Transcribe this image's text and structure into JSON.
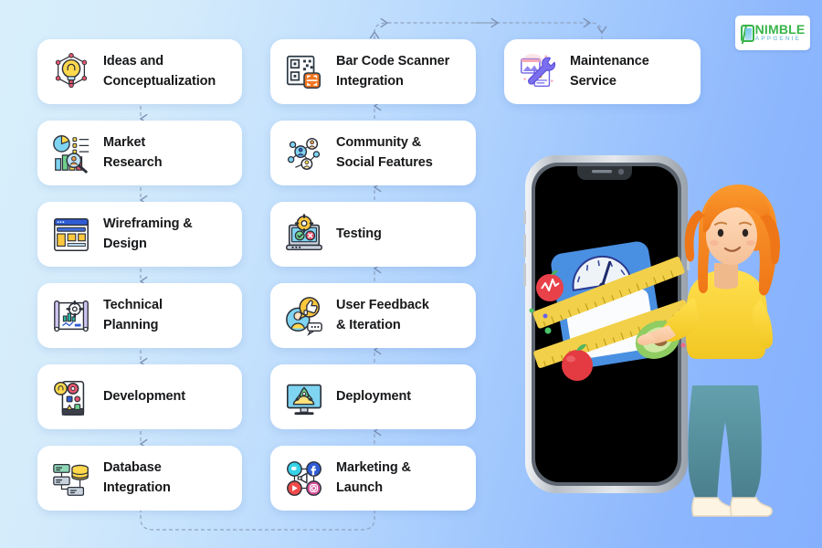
{
  "brand": {
    "name": "NIMBLE",
    "tagline": "APPGENIE",
    "logo_icon": "nimble-phone-logo-icon",
    "green": "#39b54a",
    "blue": "#8ec6de"
  },
  "background": {
    "gradient_from": "#d8effb",
    "gradient_to": "#85b0fd"
  },
  "flow": {
    "columns": [
      {
        "id": "column-1",
        "direction": "down",
        "steps": [
          {
            "label": "Ideas and\nConceptualization",
            "icon": "lightbulb-network-icon"
          },
          {
            "label": "Market\nResearch",
            "icon": "market-research-chart-icon"
          },
          {
            "label": "Wireframing &\nDesign",
            "icon": "wireframe-layout-icon"
          },
          {
            "label": "Technical\nPlanning",
            "icon": "blueprint-gear-icon"
          },
          {
            "label": "Development",
            "icon": "mobile-development-icon"
          },
          {
            "label": "Database\nIntegration",
            "icon": "database-server-icon"
          }
        ]
      },
      {
        "id": "column-2",
        "direction": "up",
        "steps": [
          {
            "label": "Bar Code Scanner\nIntegration",
            "icon": "barcode-scanner-icon"
          },
          {
            "label": "Community &\nSocial Features",
            "icon": "community-network-icon"
          },
          {
            "label": "Testing",
            "icon": "laptop-testing-icon"
          },
          {
            "label": "User Feedback\n& Iteration",
            "icon": "user-feedback-thumbsup-icon"
          },
          {
            "label": "Deployment",
            "icon": "rocket-monitor-icon"
          },
          {
            "label": "Marketing &\nLaunch",
            "icon": "social-marketing-icon"
          }
        ]
      },
      {
        "id": "column-3",
        "direction": "none",
        "steps": [
          {
            "label": "Maintenance\nService",
            "icon": "wrench-maintenance-icon"
          }
        ]
      }
    ],
    "connector_color": "#7e93b5",
    "connector_style": "dashed-with-arrowhead"
  },
  "illustration": {
    "name": "woman-with-smartphone-illustration",
    "description": "3D character standing beside a large smartphone showing a fitness app",
    "phone_screen": "black",
    "hair_color": "#f58220",
    "top_color": "#ffd93b",
    "pants_color": "#56909e",
    "app_elements": [
      "weighing-scale",
      "measuring-tape",
      "apple",
      "avocado",
      "heart-rate"
    ]
  }
}
